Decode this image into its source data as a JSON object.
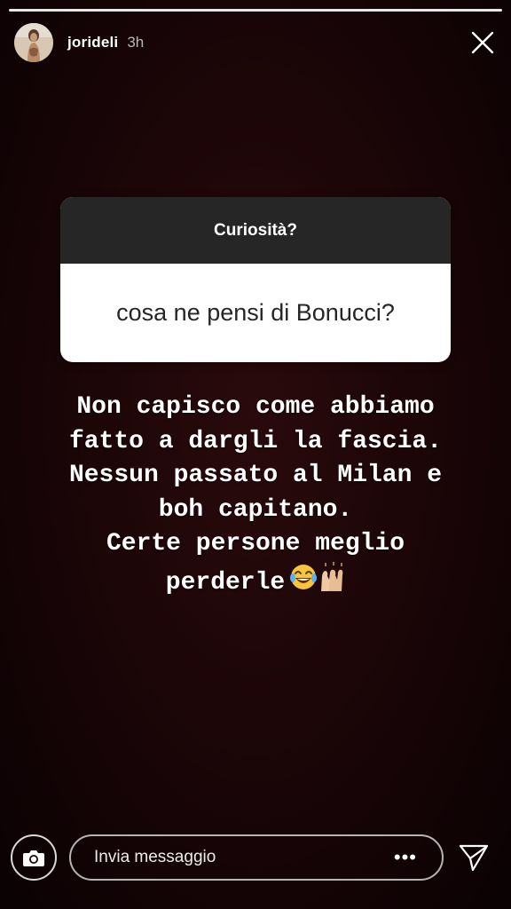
{
  "story": {
    "progress": 1.0
  },
  "header": {
    "username": "jorideli",
    "time": "3h"
  },
  "sticker": {
    "question": "Curiosità?",
    "text": "cosa ne pensi di Bonucci?"
  },
  "answer": {
    "lines": [
      "Non capisco come abbiamo",
      "fatto a dargli la fascia.",
      "Nessun passato al Milan e",
      "boh capitano.",
      "Certe persone meglio",
      "perderle"
    ],
    "emojis": "😂🙌🏼"
  },
  "bottom": {
    "placeholder": "Invia messaggio",
    "more": "•••"
  },
  "icons": {
    "close": "close-icon",
    "camera": "camera-icon",
    "send": "send-icon"
  },
  "colors": {
    "background": "#1c0608",
    "sticker_header": "#262626",
    "sticker_body": "#ffffff",
    "text": "#ffffff"
  }
}
